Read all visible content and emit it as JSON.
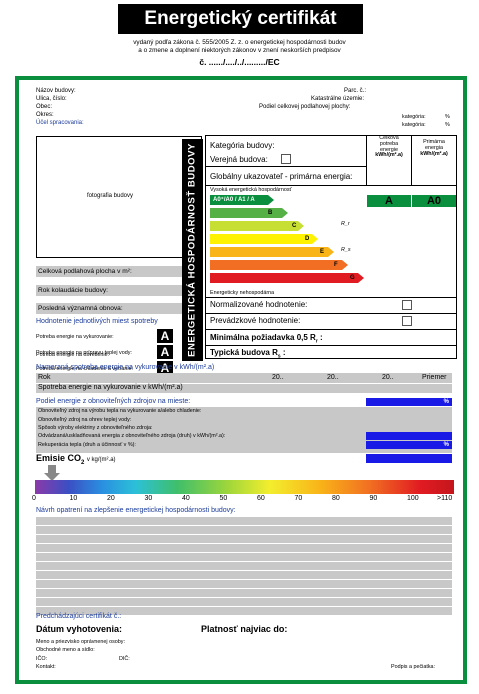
{
  "header": {
    "title": "Energetický certifikát",
    "sub1": "vydaný podľa zákona č. 555/2005 Z. z. o energetickej hospodárnosti budov",
    "sub2": "a o zmene a doplnení niektorých zákonov v znení neskorších predpisov",
    "cert_no": "č. ....../..../../........./EC"
  },
  "info": {
    "building_name": "Názov budovy:",
    "street": "Ulica, číslo:",
    "municipality": "Obec:",
    "district": "Okres:",
    "purpose": "Účel spracovania:",
    "parcel": "Parc. č.:",
    "cadastral": "Katastrálne územie:",
    "floor_area_total": "Podiel celkovej podlahovej plochy:",
    "kategoria1": "kategória:",
    "kategoria2": "kategória:",
    "pct1": "%",
    "pct2": "%"
  },
  "photo_label": "fotografia budovy",
  "vertical_label": "ENERGETICKÁ HOSPODÁRNOSŤ BUDOVY",
  "left_rows": {
    "floor_area": "Celková podlahová plocha v m²:",
    "approval_year": "Rok kolaudácie budovy:",
    "renovation": "Posledná významná obnova:"
  },
  "assess_title": "Hodnotenie jednotlivých miest spotreby",
  "assess_rows": [
    {
      "label": "Potreba energie na vykurovanie:",
      "grade": "A"
    },
    {
      "label": "Potreba energie na prípravu teplej vody:",
      "grade": "A"
    },
    {
      "label": "Potreba energie na chladenie a vetranie:",
      "grade": "A"
    },
    {
      "label": "Potreba energie na osvetlenie:",
      "grade": "A"
    }
  ],
  "rating": {
    "category": "Kategória budovy:",
    "public": "Verejná budova:",
    "global": "Globálny ukazovateľ - primárna energia:",
    "col1": [
      "Celková",
      "potreba",
      "energie",
      "kWh/(m².a)"
    ],
    "col2": [
      "Primárna",
      "energia",
      "kWh/(m².a)"
    ],
    "scale_top": "Vysoká energetická hospodárnosť",
    "scale_bottom": "Energeticky nehospodárna",
    "bands": [
      "A0⁺/A0 / A1 / A",
      "B",
      "C",
      "D",
      "E",
      "F",
      "G"
    ],
    "marker_rr": "R_r",
    "marker_rs": "R_s",
    "val1": "A",
    "val2": "A0",
    "normalized": "Normalizované hodnotenie:",
    "operational": "Prevádzkové hodnotenie:",
    "min_req": "Minimálna požiadavka 0,5 R",
    "min_req_sub": "r",
    "typical": "Typická budova R",
    "typical_sub": "s"
  },
  "measured": {
    "title": "Nameraná spotreba energie na vykurovanie v kWh/(m².a)",
    "year_label": "Rok",
    "years": [
      "20..",
      "20..",
      "20..",
      "Priemer"
    ],
    "heating": "Spotreba energie na vykurovanie v kWh/(m².a)"
  },
  "renewable": {
    "title": "Podiel energie z obnoviteľných zdrojov na mieste:",
    "pct": "%",
    "rows": [
      "Obnoviteľný zdroj na výrobu tepla na vykurovanie a/alebo chladenie:",
      "Obnoviteľný zdroj na ohrev teplej vody:",
      "Spôsob výroby elektriny z obnoviteľného zdroja:",
      "Odvádzaná/uskladňovaná energia z obnoviteľného zdroja (druh) v kWh/(m².a):",
      "Rekuperácia tepla (druh a účinnosť v %):"
    ],
    "pct2": "%"
  },
  "emissions": {
    "title": "Emisie CO",
    "sub": "2",
    "unit": "v kg/(m².a)",
    "ticks": [
      "0",
      "10",
      "20",
      "30",
      "40",
      "50",
      "60",
      "70",
      "80",
      "90",
      "100",
      ">110"
    ]
  },
  "proposal_title": "Návrh opatrení na zlepšenie energetickej hospodárnosti budovy:",
  "footer": {
    "previous": "Predchádzajúci certifikát č.:",
    "date": "Dátum vyhotovenia:",
    "valid": "Platnosť najviac do:",
    "person": "Meno a priezvisko oprávnenej osoby:",
    "company": "Obchodné meno a sídlo:",
    "ico": "IČO:",
    "dic": "DIČ:",
    "contact": "Kontakt:",
    "sign": "Podpis a pečiatka:"
  }
}
